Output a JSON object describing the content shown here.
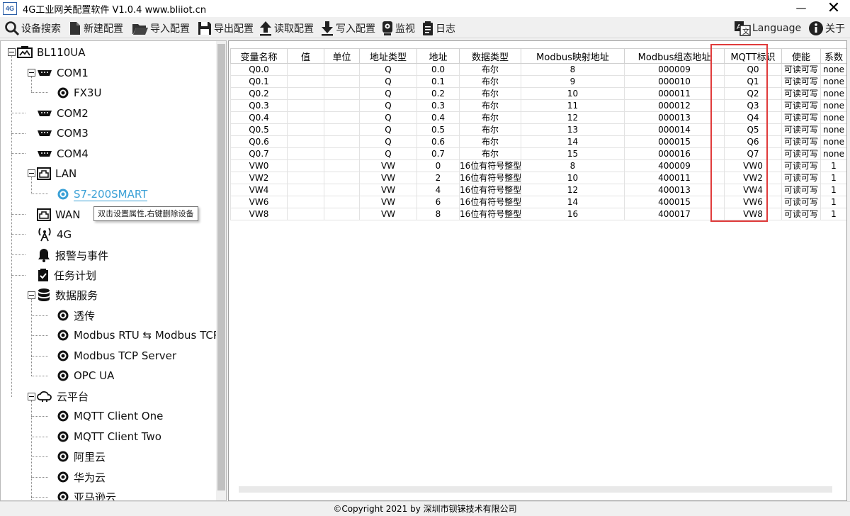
{
  "window": {
    "title": "4G工业网关配置软件 V1.0.4 www.bliiot.cn",
    "logo_text": "4G",
    "minimize_glyph": "—",
    "close_glyph": "✕"
  },
  "toolbar": {
    "device_search": "设备搜索",
    "new_config": "新建配置",
    "import_config": "导入配置",
    "export_config": "导出配置",
    "read_config": "读取配置",
    "write_config": "写入配置",
    "monitor": "监视",
    "log": "日志",
    "language": "Language",
    "about": "关于"
  },
  "tree": {
    "root": "BL110UA",
    "com1": "COM1",
    "fx3u": "FX3U",
    "com2": "COM2",
    "com3": "COM3",
    "com4": "COM4",
    "lan": "LAN",
    "s7": "S7-200SMART",
    "wan": "WAN",
    "g4": "4G",
    "alarm": "报警与事件",
    "task": "任务计划",
    "data_service": "数据服务",
    "transparent": "透传",
    "modbus_rtu_tcp": "Modbus RTU ⇆ Modbus TCP",
    "modbus_tcp_server": "Modbus TCP Server",
    "opc_ua": "OPC UA",
    "cloud": "云平台",
    "mqtt_one": "MQTT Client One",
    "mqtt_two": "MQTT Client Two",
    "aliyun": "阿里云",
    "huawei": "华为云",
    "aws": "亚马逊云"
  },
  "tooltip": "双击设置属性,右键删除设备",
  "grid": {
    "columns": [
      "变量名称",
      "值",
      "单位",
      "地址类型",
      "地址",
      "数据类型",
      "Modbus映射地址",
      "Modbus组态地址",
      "MQTT标识",
      "使能",
      "系数"
    ],
    "rows": [
      [
        "Q0.0",
        "",
        "",
        "Q",
        "0.0",
        "布尔",
        "8",
        "000009",
        "Q0",
        "可读可写",
        "none"
      ],
      [
        "Q0.1",
        "",
        "",
        "Q",
        "0.1",
        "布尔",
        "9",
        "000010",
        "Q1",
        "可读可写",
        "none"
      ],
      [
        "Q0.2",
        "",
        "",
        "Q",
        "0.2",
        "布尔",
        "10",
        "000011",
        "Q2",
        "可读可写",
        "none"
      ],
      [
        "Q0.3",
        "",
        "",
        "Q",
        "0.3",
        "布尔",
        "11",
        "000012",
        "Q3",
        "可读可写",
        "none"
      ],
      [
        "Q0.4",
        "",
        "",
        "Q",
        "0.4",
        "布尔",
        "12",
        "000013",
        "Q4",
        "可读可写",
        "none"
      ],
      [
        "Q0.5",
        "",
        "",
        "Q",
        "0.5",
        "布尔",
        "13",
        "000014",
        "Q5",
        "可读可写",
        "none"
      ],
      [
        "Q0.6",
        "",
        "",
        "Q",
        "0.6",
        "布尔",
        "14",
        "000015",
        "Q6",
        "可读可写",
        "none"
      ],
      [
        "Q0.7",
        "",
        "",
        "Q",
        "0.7",
        "布尔",
        "15",
        "000016",
        "Q7",
        "可读可写",
        "none"
      ],
      [
        "VW0",
        "",
        "",
        "VW",
        "0",
        "16位有符号整型",
        "8",
        "400009",
        "VW0",
        "可读可写",
        "1"
      ],
      [
        "VW2",
        "",
        "",
        "VW",
        "2",
        "16位有符号整型",
        "10",
        "400011",
        "VW2",
        "可读可写",
        "1"
      ],
      [
        "VW4",
        "",
        "",
        "VW",
        "4",
        "16位有符号整型",
        "12",
        "400013",
        "VW4",
        "可读可写",
        "1"
      ],
      [
        "VW6",
        "",
        "",
        "VW",
        "6",
        "16位有符号整型",
        "14",
        "400015",
        "VW6",
        "可读可写",
        "1"
      ],
      [
        "VW8",
        "",
        "",
        "VW",
        "8",
        "16位有符号整型",
        "16",
        "400017",
        "VW8",
        "可读可写",
        "1"
      ]
    ],
    "highlight_color": "#e03b3b"
  },
  "status": {
    "copyright": "©Copyright 2021 by 深圳市钡铼技术有限公司"
  },
  "colors": {
    "selected": "#3aa0d6",
    "highlight": "#e03b3b"
  }
}
